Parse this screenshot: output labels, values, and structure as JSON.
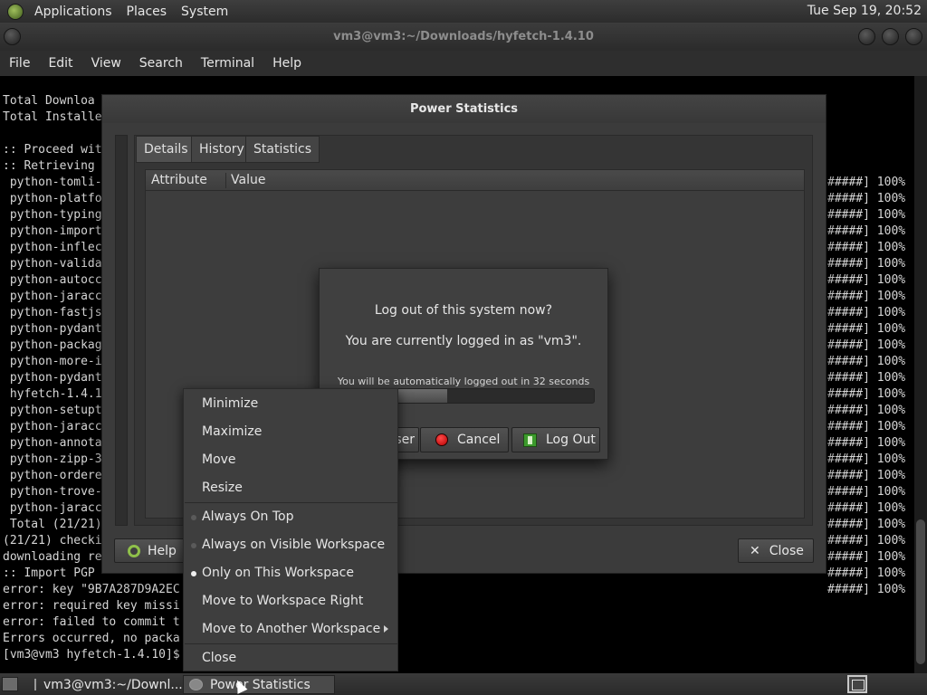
{
  "top_panel": {
    "menus": [
      "Applications",
      "Places",
      "System"
    ],
    "clock": "Tue Sep 19, 20:52"
  },
  "terminal": {
    "title": "vm3@vm3:~/Downloads/hyfetch-1.4.10",
    "menu": [
      "File",
      "Edit",
      "View",
      "Search",
      "Terminal",
      "Help"
    ],
    "lines_left": [
      "Total Downloa",
      "Total Installe",
      "",
      ":: Proceed wit",
      ":: Retrieving",
      " python-tomli-",
      " python-platfo",
      " python-typing",
      " python-import",
      " python-inflec",
      " python-valida",
      " python-autocc",
      " python-jaracc",
      " python-fastjs",
      " python-pydant",
      " python-packag",
      " python-more-i",
      " python-pydant",
      " hyfetch-1.4.1",
      " python-setupt",
      " python-jaracc",
      " python-annota",
      " python-zipp-3",
      " python-ordere",
      " python-trove-",
      " python-jaracc",
      " Total (21/21)",
      "(21/21) checki",
      "downloading re",
      ":: Import PGP",
      "error: key \"9B7A287D9A2EC",
      "error: required key missi",
      "error: failed to commit t",
      "Errors occurred, no packa",
      "[vm3@vm3 hyfetch-1.4.10]$"
    ],
    "lines_right": [
      "#####] 100%",
      "#####] 100%",
      "#####] 100%",
      "#####] 100%",
      "#####] 100%",
      "#####] 100%",
      "#####] 100%",
      "#####] 100%",
      "#####] 100%",
      "#####] 100%",
      "#####] 100%",
      "#####] 100%",
      "#####] 100%",
      "#####] 100%",
      "#####] 100%",
      "#####] 100%",
      "#####] 100%",
      "#####] 100%",
      "#####] 100%",
      "#####] 100%",
      "#####] 100%",
      "#####] 100%",
      "#####] 100%",
      "#####] 100%",
      "#####] 100%",
      "#####] 100%"
    ]
  },
  "power_dialog": {
    "title": "Power Statistics",
    "tabs": [
      "Details",
      "History",
      "Statistics"
    ],
    "columns": [
      "Attribute",
      "Value"
    ],
    "help_label": "Help",
    "close_label": "Close"
  },
  "logout_dialog": {
    "question": "Log out of this system now?",
    "user_line": "You are currently logged in as \"vm3\".",
    "auto_text": "You will be automatically logged out in 32 seconds",
    "progress": 0.38,
    "switch_user_label": "ser",
    "cancel_label": "Cancel",
    "logout_label": "Log Out"
  },
  "context_menu": {
    "items": [
      "Minimize",
      "Maximize",
      "Move",
      "Resize",
      "Always On Top",
      "Always on Visible Workspace",
      "Only on This Workspace",
      "Move to Workspace Right",
      "Move to Another Workspace",
      "Close"
    ]
  },
  "bottom_panel": {
    "tasks": [
      "vm3@vm3:~/Downl...",
      "Power Statistics"
    ]
  }
}
